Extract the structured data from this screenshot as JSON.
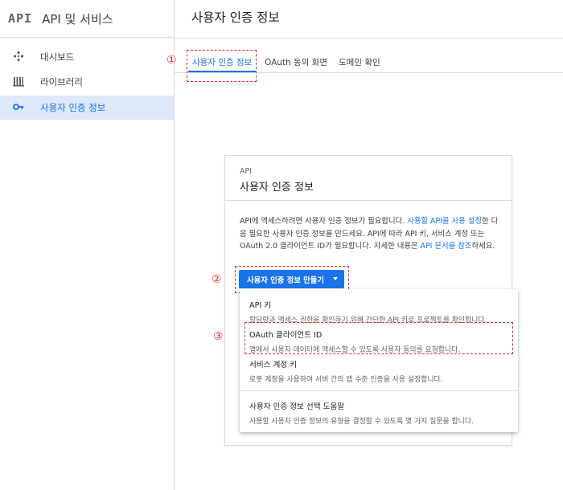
{
  "sidebar": {
    "logo": "API",
    "title": "API 및 서비스",
    "items": [
      {
        "label": "대시보드",
        "icon": "dashboard-icon"
      },
      {
        "label": "라이브러리",
        "icon": "library-icon"
      },
      {
        "label": "사용자 인증 정보",
        "icon": "key-icon",
        "active": true
      }
    ]
  },
  "header": {
    "title": "사용자 인증 정보"
  },
  "tabs": [
    {
      "label": "사용자 인증 정보",
      "active": true
    },
    {
      "label": "OAuth 동의 화면"
    },
    {
      "label": "도메인 확인"
    }
  ],
  "annotations": [
    "①",
    "②",
    "③"
  ],
  "card": {
    "eyebrow": "API",
    "title": "사용자 인증 정보",
    "desc": {
      "p1": "API에 액세스하려면 사용자 인증 정보가 필요합니다. ",
      "link1": "사용할 API를 사용 설정",
      "p2": "한 다음 필요한 사용자 인증 정보를 만드세요. API에 따라 API 키, 서비스 계정 또는 OAuth 2.0 클라이언트 ID가 필요합니다. 자세한 내용은 ",
      "link2": "API 문서를 참조",
      "p3": "하세요."
    },
    "create_button": "사용자 인증 정보 만들기"
  },
  "menu": {
    "items": [
      {
        "title": "API 키",
        "desc": "할당량과 액세스 권한을 확인하기 위해 간단한 API 키로 프로젝트를 확인합니다."
      },
      {
        "title": "OAuth 클라이언트 ID",
        "desc": "앱에서 사용자 데이터에 액세스할 수 있도록 사용자 동의를 요청합니다."
      },
      {
        "title": "서비스 계정 키",
        "desc": "로봇 계정을 사용하여 서버 간의 앱 수준 인증을 사용 설정합니다."
      },
      {
        "title": "사용자 인증 정보 선택 도움말",
        "desc": "사용할 사용자 인증 정보의 유형을 결정할 수 있도록 몇 가지 질문을 합니다."
      }
    ]
  },
  "colors": {
    "accent": "#1a73e8",
    "annotation": "#d93025",
    "active_bg": "#dde8f9"
  }
}
